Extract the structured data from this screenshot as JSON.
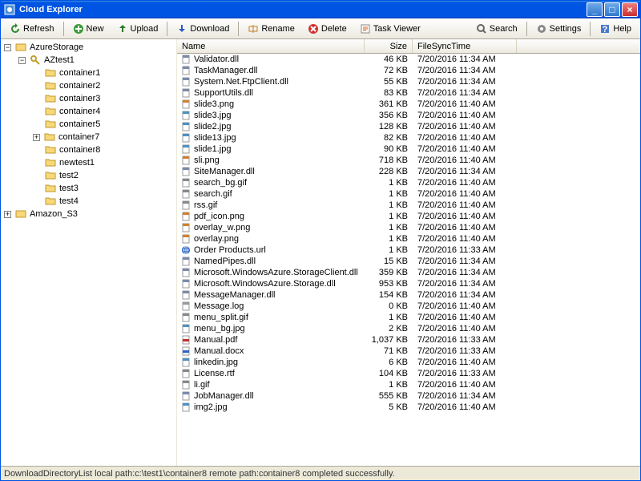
{
  "window": {
    "title": "Cloud Explorer"
  },
  "toolbar": {
    "refresh": "Refresh",
    "new": "New",
    "upload": "Upload",
    "download": "Download",
    "rename": "Rename",
    "delete": "Delete",
    "taskviewer": "Task Viewer",
    "search": "Search",
    "settings": "Settings",
    "help": "Help"
  },
  "tree": {
    "r0": "AzureStorage",
    "r1": "AZtest1",
    "c1": "container1",
    "c2": "container2",
    "c3": "container3",
    "c4": "container4",
    "c5": "container5",
    "c7": "container7",
    "c8": "container8",
    "n1": "newtest1",
    "t2": "test2",
    "t3": "test3",
    "t4": "test4",
    "s3": "Amazon_S3"
  },
  "columns": {
    "name": "Name",
    "size": "Size",
    "time": "FileSyncTime"
  },
  "files": [
    {
      "n": "Validator.dll",
      "s": "46 KB",
      "t": "7/20/2016 11:34 AM",
      "k": "dll"
    },
    {
      "n": "TaskManager.dll",
      "s": "72 KB",
      "t": "7/20/2016 11:34 AM",
      "k": "dll"
    },
    {
      "n": "System.Net.FtpClient.dll",
      "s": "55 KB",
      "t": "7/20/2016 11:34 AM",
      "k": "dll"
    },
    {
      "n": "SupportUtils.dll",
      "s": "83 KB",
      "t": "7/20/2016 11:34 AM",
      "k": "dll"
    },
    {
      "n": "slide3.png",
      "s": "361 KB",
      "t": "7/20/2016 11:40 AM",
      "k": "png"
    },
    {
      "n": "slide3.jpg",
      "s": "356 KB",
      "t": "7/20/2016 11:40 AM",
      "k": "jpg"
    },
    {
      "n": "slide2.jpg",
      "s": "128 KB",
      "t": "7/20/2016 11:40 AM",
      "k": "jpg"
    },
    {
      "n": "slide13.jpg",
      "s": "82 KB",
      "t": "7/20/2016 11:40 AM",
      "k": "jpg"
    },
    {
      "n": "slide1.jpg",
      "s": "90 KB",
      "t": "7/20/2016 11:40 AM",
      "k": "jpg"
    },
    {
      "n": "sli.png",
      "s": "718 KB",
      "t": "7/20/2016 11:40 AM",
      "k": "png"
    },
    {
      "n": "SiteManager.dll",
      "s": "228 KB",
      "t": "7/20/2016 11:34 AM",
      "k": "dll"
    },
    {
      "n": "search_bg.gif",
      "s": "1 KB",
      "t": "7/20/2016 11:40 AM",
      "k": "gif"
    },
    {
      "n": "search.gif",
      "s": "1 KB",
      "t": "7/20/2016 11:40 AM",
      "k": "gif"
    },
    {
      "n": "rss.gif",
      "s": "1 KB",
      "t": "7/20/2016 11:40 AM",
      "k": "gif"
    },
    {
      "n": "pdf_icon.png",
      "s": "1 KB",
      "t": "7/20/2016 11:40 AM",
      "k": "png"
    },
    {
      "n": "overlay_w.png",
      "s": "1 KB",
      "t": "7/20/2016 11:40 AM",
      "k": "png"
    },
    {
      "n": "overlay.png",
      "s": "1 KB",
      "t": "7/20/2016 11:40 AM",
      "k": "png"
    },
    {
      "n": "Order Products.url",
      "s": "1 KB",
      "t": "7/20/2016 11:33 AM",
      "k": "url"
    },
    {
      "n": "NamedPipes.dll",
      "s": "15 KB",
      "t": "7/20/2016 11:34 AM",
      "k": "dll"
    },
    {
      "n": "Microsoft.WindowsAzure.StorageClient.dll",
      "s": "359 KB",
      "t": "7/20/2016 11:34 AM",
      "k": "dll"
    },
    {
      "n": "Microsoft.WindowsAzure.Storage.dll",
      "s": "953 KB",
      "t": "7/20/2016 11:34 AM",
      "k": "dll"
    },
    {
      "n": "MessageManager.dll",
      "s": "154 KB",
      "t": "7/20/2016 11:34 AM",
      "k": "dll"
    },
    {
      "n": "Message.log",
      "s": "0 KB",
      "t": "7/20/2016 11:40 AM",
      "k": "log"
    },
    {
      "n": "menu_split.gif",
      "s": "1 KB",
      "t": "7/20/2016 11:40 AM",
      "k": "gif"
    },
    {
      "n": "menu_bg.jpg",
      "s": "2 KB",
      "t": "7/20/2016 11:40 AM",
      "k": "jpg"
    },
    {
      "n": "Manual.pdf",
      "s": "1,037 KB",
      "t": "7/20/2016 11:33 AM",
      "k": "pdf"
    },
    {
      "n": "Manual.docx",
      "s": "71 KB",
      "t": "7/20/2016 11:33 AM",
      "k": "doc"
    },
    {
      "n": "linkedin.jpg",
      "s": "6 KB",
      "t": "7/20/2016 11:40 AM",
      "k": "jpg"
    },
    {
      "n": "License.rtf",
      "s": "104 KB",
      "t": "7/20/2016 11:33 AM",
      "k": "rtf"
    },
    {
      "n": "li.gif",
      "s": "1 KB",
      "t": "7/20/2016 11:40 AM",
      "k": "gif"
    },
    {
      "n": "JobManager.dll",
      "s": "555 KB",
      "t": "7/20/2016 11:34 AM",
      "k": "dll"
    },
    {
      "n": "img2.jpg",
      "s": "5 KB",
      "t": "7/20/2016 11:40 AM",
      "k": "jpg"
    }
  ],
  "status": "DownloadDirectoryList local path:c:\\test1\\container8 remote path:container8 completed successfully."
}
